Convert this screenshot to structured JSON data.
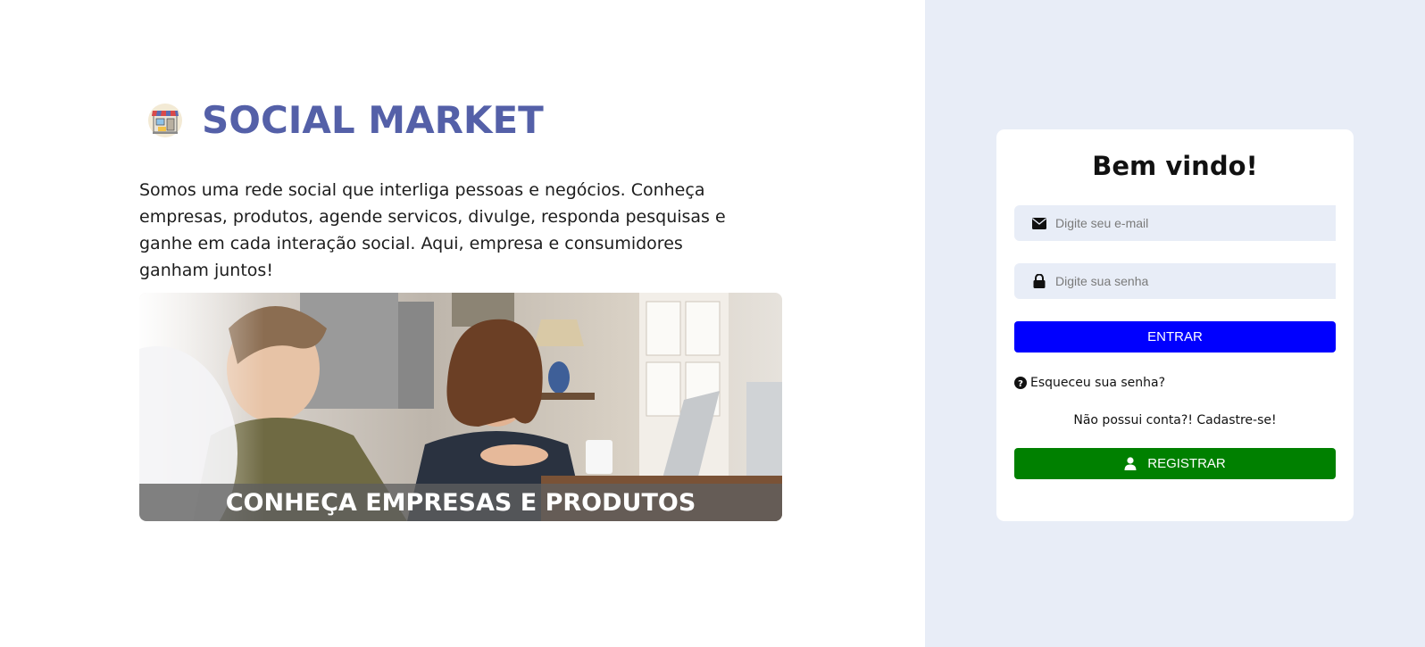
{
  "brand": {
    "title": "SOCIAL MARKET",
    "logo_icon": "storefront-icon",
    "title_color": "#5460a8"
  },
  "intro": {
    "text": "Somos uma rede social que interliga pessoas e negócios. Conheça empresas, produtos, agende servicos, divulge, responda pesquisas e ganhe em cada interação social. Aqui, empresa e consumidores ganham juntos!"
  },
  "hero": {
    "caption": "CONHEÇA EMPRESAS E PRODUTOS"
  },
  "login": {
    "title": "Bem vindo!",
    "email_placeholder": "Digite seu e-mail",
    "email_value": "",
    "email_icon": "envelope-icon",
    "password_placeholder": "Digite sua senha",
    "password_value": "",
    "password_icon": "lock-icon",
    "enter_label": "ENTRAR",
    "enter_color": "#0000ff",
    "forgot_label": "Esqueceu sua senha?",
    "forgot_icon": "question-circle-icon",
    "signup_text": "Não possui conta?! Cadastre-se!",
    "register_label": "REGISTRAR",
    "register_icon": "user-icon",
    "register_color": "#008000"
  },
  "colors": {
    "right_panel_bg": "#e8edf7",
    "input_bg": "#e8edf7"
  }
}
